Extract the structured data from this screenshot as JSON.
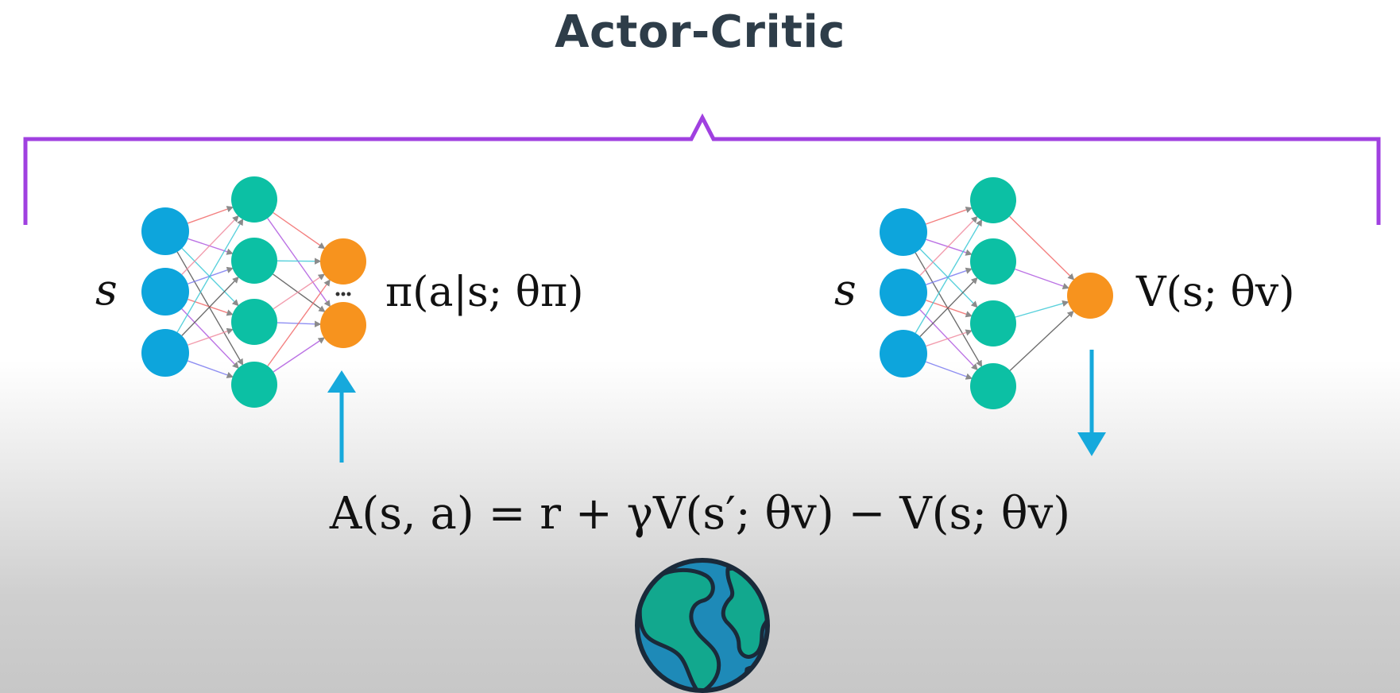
{
  "title": "Actor-Critic",
  "actor": {
    "input_label": "s",
    "output_label": "π(a|s; θπ)"
  },
  "critic": {
    "input_label": "s",
    "output_label": "V(s; θv)"
  },
  "advantage_equation": "A(s, a) = r + γV(s′; θv) − V(s; θv)",
  "colors": {
    "bracket": "#a040e0",
    "input_node": "#0da5dc",
    "hidden_node": "#0cc0a4",
    "output_node": "#f7931e",
    "arrow": "#16a9dc",
    "title": "#2e3d49"
  },
  "icons": {
    "environment": "earth-globe-icon"
  }
}
